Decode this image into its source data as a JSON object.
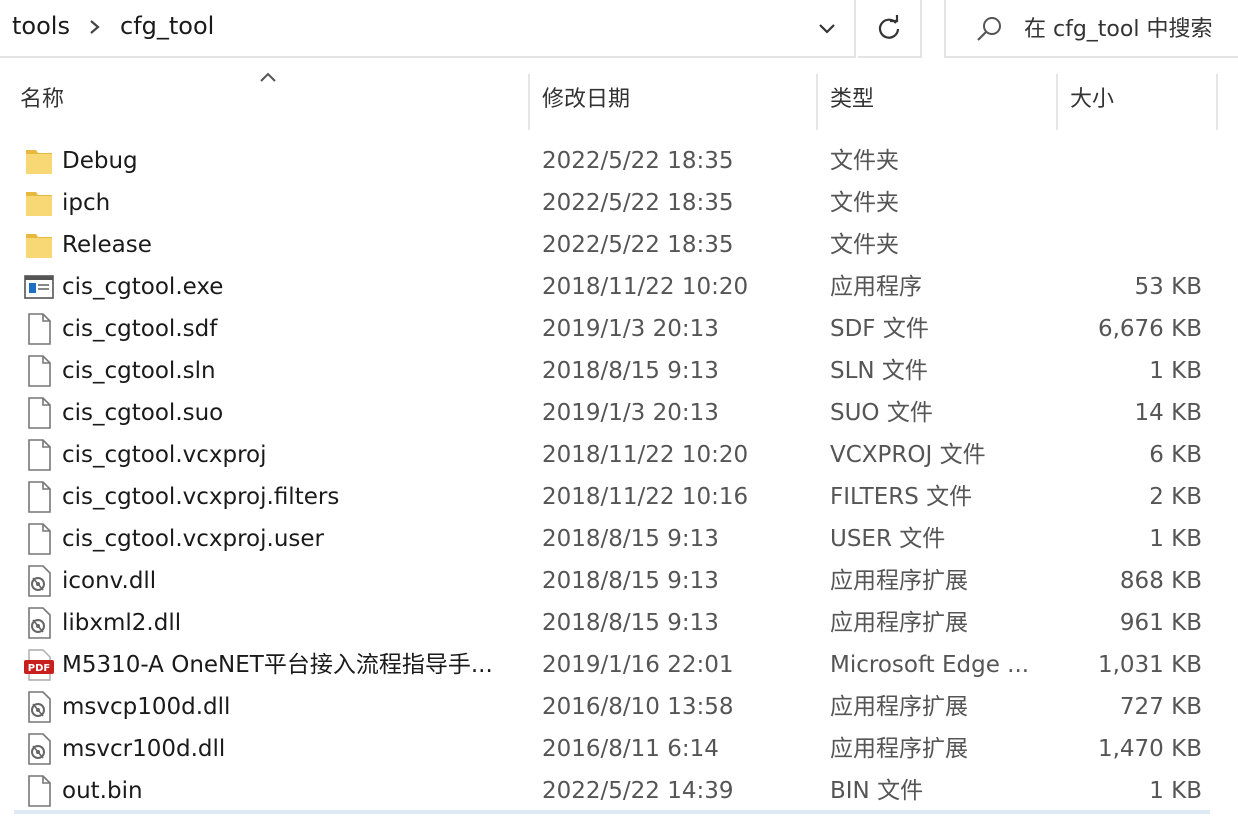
{
  "address_bar": {
    "breadcrumbs": [
      "tools",
      "cfg_tool"
    ],
    "separator_icon": "chevron-right-icon"
  },
  "search": {
    "placeholder": "在 cfg_tool 中搜索",
    "icon": "search-icon"
  },
  "columns": {
    "name": "名称",
    "date": "修改日期",
    "type": "类型",
    "size": "大小",
    "sorted_by": "name"
  },
  "files": [
    {
      "name": "Debug",
      "date": "2022/5/22 18:35",
      "type": "文件夹",
      "size": "",
      "icon": "folder-icon"
    },
    {
      "name": "ipch",
      "date": "2022/5/22 18:35",
      "type": "文件夹",
      "size": "",
      "icon": "folder-icon"
    },
    {
      "name": "Release",
      "date": "2022/5/22 18:35",
      "type": "文件夹",
      "size": "",
      "icon": "folder-icon"
    },
    {
      "name": "cis_cgtool.exe",
      "date": "2018/11/22 10:20",
      "type": "应用程序",
      "size": "53 KB",
      "icon": "exe-icon"
    },
    {
      "name": "cis_cgtool.sdf",
      "date": "2019/1/3 20:13",
      "type": "SDF 文件",
      "size": "6,676 KB",
      "icon": "file-icon"
    },
    {
      "name": "cis_cgtool.sln",
      "date": "2018/8/15 9:13",
      "type": "SLN 文件",
      "size": "1 KB",
      "icon": "file-icon"
    },
    {
      "name": "cis_cgtool.suo",
      "date": "2019/1/3 20:13",
      "type": "SUO 文件",
      "size": "14 KB",
      "icon": "file-icon"
    },
    {
      "name": "cis_cgtool.vcxproj",
      "date": "2018/11/22 10:20",
      "type": "VCXPROJ 文件",
      "size": "6 KB",
      "icon": "file-icon"
    },
    {
      "name": "cis_cgtool.vcxproj.filters",
      "date": "2018/11/22 10:16",
      "type": "FILTERS 文件",
      "size": "2 KB",
      "icon": "file-icon"
    },
    {
      "name": "cis_cgtool.vcxproj.user",
      "date": "2018/8/15 9:13",
      "type": "USER 文件",
      "size": "1 KB",
      "icon": "file-icon"
    },
    {
      "name": "iconv.dll",
      "date": "2018/8/15 9:13",
      "type": "应用程序扩展",
      "size": "868 KB",
      "icon": "dll-icon"
    },
    {
      "name": "libxml2.dll",
      "date": "2018/8/15 9:13",
      "type": "应用程序扩展",
      "size": "961 KB",
      "icon": "dll-icon"
    },
    {
      "name": "M5310-A OneNET平台接入流程指导手...",
      "date": "2019/1/16 22:01",
      "type": "Microsoft Edge ...",
      "size": "1,031 KB",
      "icon": "pdf-icon"
    },
    {
      "name": "msvcp100d.dll",
      "date": "2016/8/10 13:58",
      "type": "应用程序扩展",
      "size": "727 KB",
      "icon": "dll-icon"
    },
    {
      "name": "msvcr100d.dll",
      "date": "2016/8/11 6:14",
      "type": "应用程序扩展",
      "size": "1,470 KB",
      "icon": "dll-icon"
    },
    {
      "name": "out.bin",
      "date": "2022/5/22 14:39",
      "type": "BIN 文件",
      "size": "1 KB",
      "icon": "file-icon"
    }
  ],
  "colors": {
    "folder": "#f8d775",
    "folder_dark": "#e8b93f",
    "exe_blue": "#1f6fc5",
    "pdf_red": "#c8201e",
    "border": "#e3e3e3"
  }
}
